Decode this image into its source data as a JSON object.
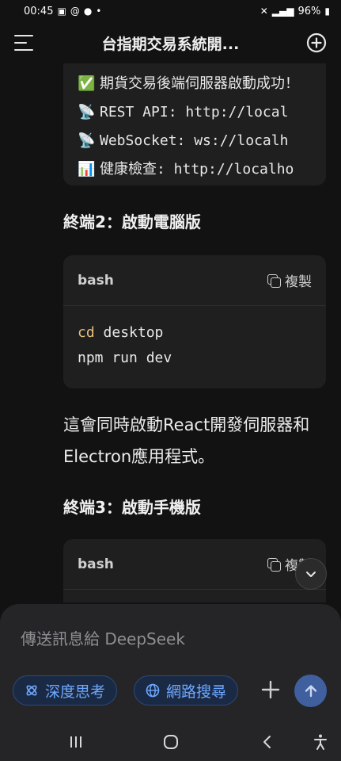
{
  "status_bar": {
    "time": "00:45",
    "battery": "96%"
  },
  "header": {
    "title": "台指期交易系統開..."
  },
  "output_lines": [
    {
      "emoji": "✅",
      "text": "期貨交易後端伺服器啟動成功！"
    },
    {
      "emoji": "📡",
      "text": "REST API: http://local"
    },
    {
      "emoji": "📡",
      "text": "WebSocket: ws://localh"
    },
    {
      "emoji": "📊",
      "text": "健康檢查: http://localho"
    }
  ],
  "section2": {
    "heading": "終端2：啟動電腦版",
    "lang": "bash",
    "copy_label": "複製",
    "code": {
      "cmd1_kw": "cd",
      "cmd1_arg": " desktop",
      "cmd2": "npm run dev"
    }
  },
  "paragraph": "這會同時啟動React開發伺服器和Electron應用程式。",
  "section3": {
    "heading": "終端3：啟動手機版",
    "lang": "bash",
    "copy_label": "複製"
  },
  "composer": {
    "placeholder": "傳送訊息給 DeepSeek",
    "deep_think_label": "深度思考",
    "web_search_label": "網路搜尋"
  },
  "colors": {
    "accent": "#6fa8ff",
    "send_bg": "#3f5f9f",
    "keyword": "#e5c07b"
  }
}
